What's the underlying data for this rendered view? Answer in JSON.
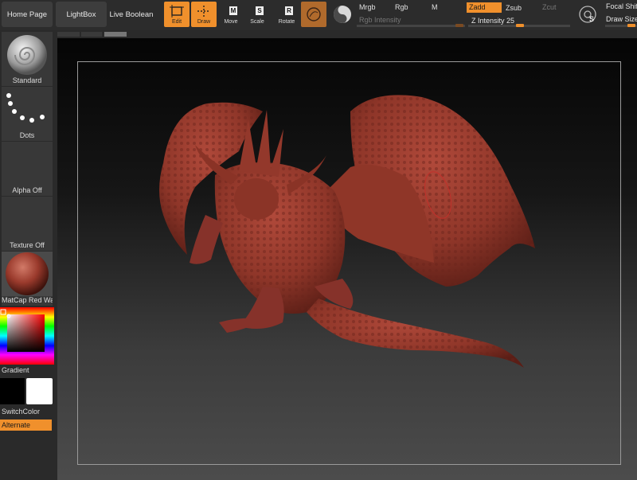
{
  "nav": {
    "home_page": "Home Page",
    "lightbox": "LightBox",
    "live_boolean": "Live Boolean"
  },
  "tools": {
    "edit": "Edit",
    "draw": "Draw",
    "move": "Move",
    "scale": "Scale",
    "rotate": "Rotate"
  },
  "modes": {
    "mrgb": "Mrgb",
    "rgb": "Rgb",
    "m": "M",
    "zadd": "Zadd",
    "zsub": "Zsub",
    "zcut": "Zcut"
  },
  "sliders": {
    "rgb_intensity_label": "Rgb Intensity",
    "z_intensity_label": "Z Intensity",
    "z_intensity_value": "25"
  },
  "right_panel": {
    "focal_shift": "Focal Shift",
    "draw_size": "Draw Size"
  },
  "tray": {
    "brush": "Standard",
    "stroke": "Dots",
    "alpha": "Alpha Off",
    "texture": "Texture Off",
    "material": "MatCap Red Wax",
    "gradient": "Gradient",
    "switch_color": "SwitchColor",
    "alternate": "Alternate"
  },
  "colors": {
    "accent": "#f0902c",
    "model": "#9a3a2c",
    "main_color": "#000000",
    "secondary_color": "#ffffff"
  },
  "icons": {
    "light_box_icon": "sphere-settings-icon",
    "record_icon": "circle-icon",
    "material_icon": "s-circle-icon"
  }
}
